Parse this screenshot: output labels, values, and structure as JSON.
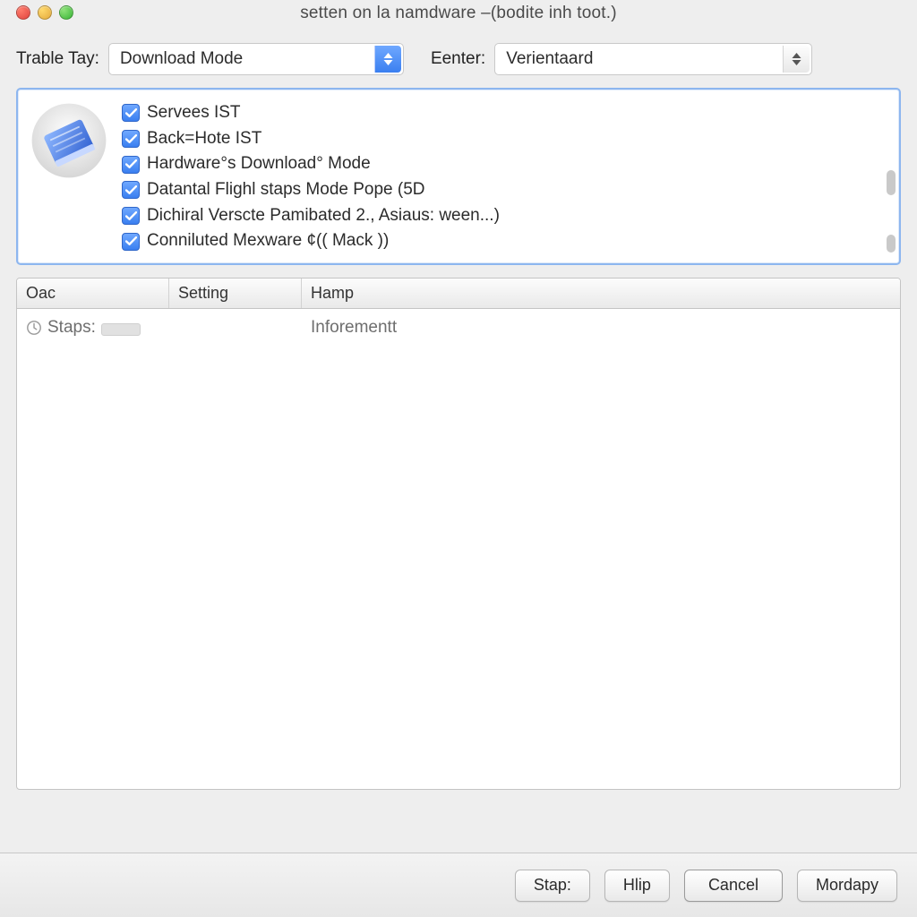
{
  "window": {
    "title": "setten on la namdware –(bodite inh toot.)"
  },
  "toolbar": {
    "trable_label": "Trable Tay:",
    "trable_value": "Download Mode",
    "eenter_label": "Eenter:",
    "eenter_value": "Verientaard"
  },
  "panel": {
    "items": [
      "Servees IST",
      "Back=Hote IST",
      "Hardware°s Download° Mode",
      "Datantal Flighl staps Mode Pope (5D",
      "Dichiral Verscte Pamibated 2., Asiaus: ween...)",
      "Conniluted Mexware ¢(( Mack ))"
    ]
  },
  "table": {
    "headers": {
      "col1": "Oac",
      "col2": "Setting",
      "col3": "Hamp"
    },
    "rows": [
      {
        "col1": "Staps:",
        "col2": "",
        "col3": "Inforementt"
      }
    ]
  },
  "footer": {
    "stap": "Stap:",
    "hlip": "Hlip",
    "cancel": "Cancel",
    "mordapy": "Mordapy"
  }
}
